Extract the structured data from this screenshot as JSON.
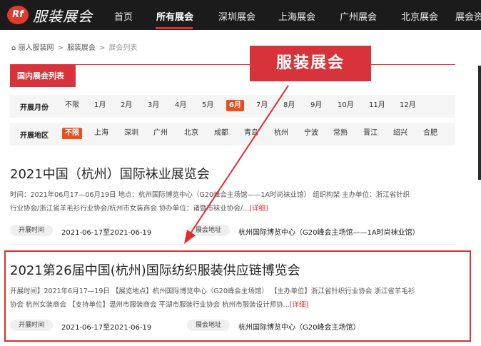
{
  "header": {
    "logo_mark": "Rf",
    "site_title": "服装展会",
    "nav": [
      {
        "label": "首页",
        "active": false
      },
      {
        "label": "所有展会",
        "active": true
      },
      {
        "label": "深圳展会",
        "active": false
      },
      {
        "label": "上海展会",
        "active": false
      },
      {
        "label": "广州展会",
        "active": false
      },
      {
        "label": "北京展会",
        "active": false
      },
      {
        "label": "展会资",
        "active": false
      }
    ]
  },
  "breadcrumb": [
    "丽人服装网",
    "服装展会",
    "展会列表"
  ],
  "banner": "服装展会",
  "section_tab": "国内展会列表",
  "filters": {
    "month": {
      "label": "开展月份",
      "options": [
        "不限",
        "1月",
        "2月",
        "3月",
        "4月",
        "5月",
        "6月",
        "7月",
        "8月",
        "9月",
        "10月",
        "11月",
        "12月"
      ],
      "selected": "6月"
    },
    "region": {
      "label": "开展地区",
      "options": [
        "不限",
        "上海",
        "深圳",
        "广州",
        "北京",
        "成都",
        "青岛",
        "杭州",
        "宁波",
        "常熟",
        "晋江",
        "绍兴",
        "合肥"
      ],
      "selected": "不限"
    }
  },
  "expos": [
    {
      "title": "2021中国（杭州）国际袜业展览会",
      "desc_line1": "时间：2021年06月17—06月19日 地点：杭州国际博览中心（G20峰会主场馆——1A时尚袜业馆） 组织构架 主办单位：浙江省针织",
      "desc_line2": "行业协会/浙江省羊毛衫行业协会/杭州市女装商会 协办单位：诸暨市袜业协会/...",
      "detail": "[详细]",
      "time_tag": "开展时间",
      "time_value": "2021-06-17至2021-06-19",
      "addr_tag": "展会地址",
      "addr_value": "杭州国际博览中心（G20峰会主场馆——1A时尚袜业馆）"
    },
    {
      "title": "2021第26届中国(杭州)国际纺织服装供应链博览会",
      "desc_line1": "开展时间】2021年6月17—19日 【展览地点】杭州国际博览中心（G20峰会主场馆） 【主办单位】浙江省针织行业协会 浙江省羊毛衫",
      "desc_line2": "协会 杭州女装商会 【支持单位】温州市服装商会 平湖市服装行业协会 杭州市服装设计师协...",
      "detail": "[详细]",
      "time_tag": "开展时间",
      "time_value": "2021-06-17至2021-06-19",
      "addr_tag": "展会地址",
      "addr_value": "杭州国际博览中心（G20峰会主场馆）"
    }
  ],
  "colors": {
    "accent": "#e02d2d",
    "topbar": "#1b1b1b",
    "selected": "#e8501f"
  }
}
